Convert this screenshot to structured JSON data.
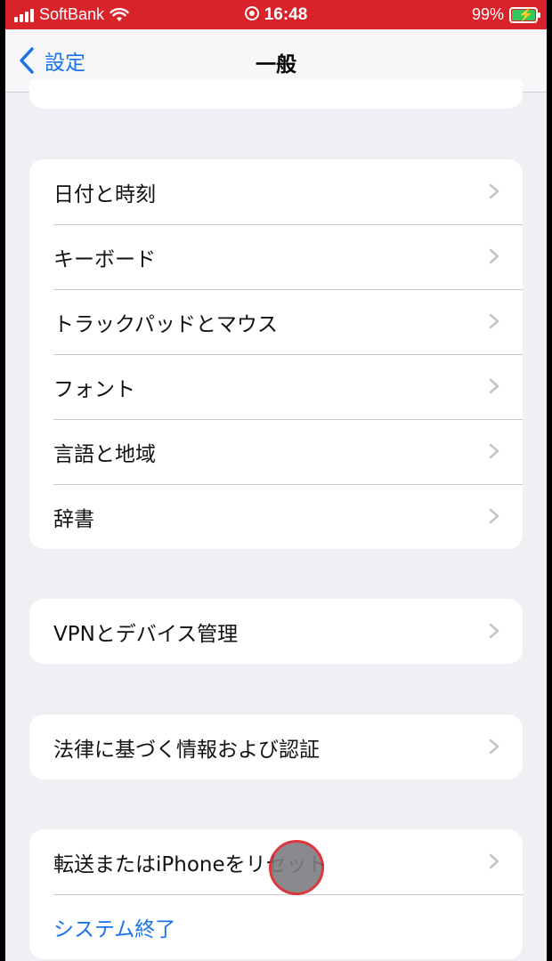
{
  "status_bar": {
    "carrier": "SoftBank",
    "time": "16:48",
    "battery": "99%"
  },
  "nav": {
    "back_label": "設定",
    "title": "一般"
  },
  "groups": [
    {
      "items": [
        {
          "label": "日付と時刻"
        },
        {
          "label": "キーボード"
        },
        {
          "label": "トラックパッドとマウス"
        },
        {
          "label": "フォント"
        },
        {
          "label": "言語と地域"
        },
        {
          "label": "辞書"
        }
      ]
    },
    {
      "items": [
        {
          "label": "VPNとデバイス管理"
        }
      ]
    },
    {
      "items": [
        {
          "label": "法律に基づく情報および認証"
        }
      ]
    },
    {
      "items": [
        {
          "label": "転送またはiPhoneをリセット"
        },
        {
          "label": "システム終了"
        }
      ]
    }
  ],
  "colors": {
    "accent": "#1a73e8",
    "status_bar": "#d8232a",
    "battery_fill": "#34c759"
  }
}
